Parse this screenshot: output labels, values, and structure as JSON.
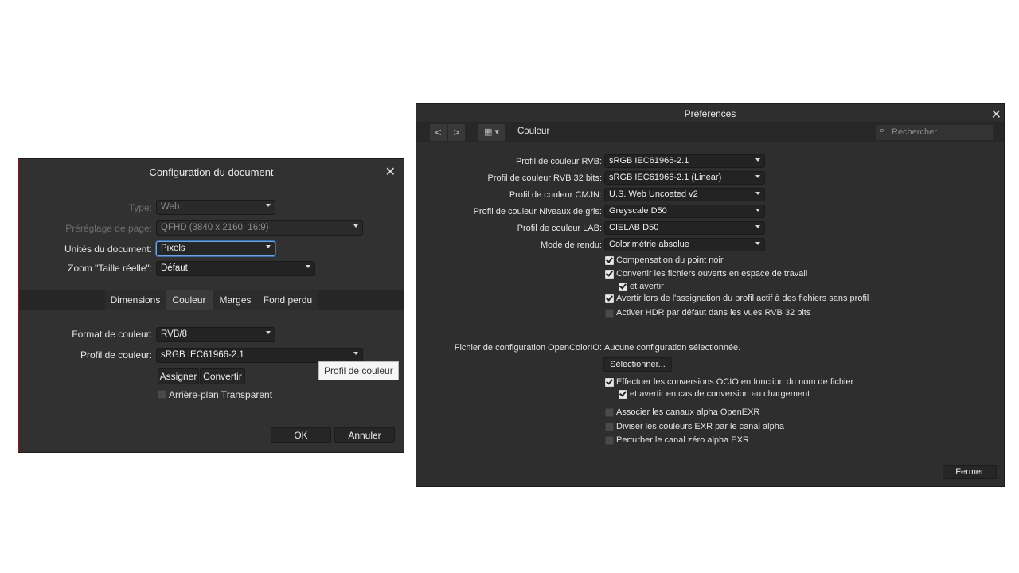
{
  "doc_dialog": {
    "title": "Configuration du document",
    "type_label": "Type:",
    "type_value": "Web",
    "preset_label": "Préréglage de page:",
    "preset_value": "QFHD  (3840 x 2160, 16:9)",
    "units_label": "Unités du document:",
    "units_value": "Pixels",
    "zoom_label": "Zoom \"Taille réelle\":",
    "zoom_value": "Défaut",
    "tabs": [
      "Dimensions",
      "Couleur",
      "Marges",
      "Fond perdu"
    ],
    "active_tab": "Couleur",
    "format_label": "Format de couleur:",
    "format_value": "RVB/8",
    "profile_label": "Profil de couleur:",
    "profile_value": "sRGB IEC61966-2.1",
    "assign_label": "Assigner",
    "convert_label": "Convertir",
    "transparent_label": "Arrière-plan Transparent",
    "tooltip": "Profil de couleur",
    "ok_label": "OK",
    "cancel_label": "Annuler"
  },
  "prefs_dialog": {
    "title": "Préférences",
    "section": "Couleur",
    "search_placeholder": "Rechercher",
    "rows": [
      {
        "label": "Profil de couleur RVB:",
        "value": "sRGB IEC61966-2.1"
      },
      {
        "label": "Profil de couleur RVB 32 bits:",
        "value": "sRGB IEC61966-2.1 (Linear)"
      },
      {
        "label": "Profil de couleur CMJN:",
        "value": "U.S. Web Uncoated v2"
      },
      {
        "label": "Profil de couleur Niveaux de gris:",
        "value": "Greyscale D50"
      },
      {
        "label": "Profil de couleur LAB:",
        "value": "CIELAB D50"
      },
      {
        "label": "Mode de rendu:",
        "value": "Colorimétrie absolue"
      }
    ],
    "checks": [
      {
        "label": "Compensation du point noir",
        "checked": true
      },
      {
        "label": "Convertir les fichiers ouverts en espace de travail",
        "checked": true
      },
      {
        "label": "et avertir",
        "checked": true
      },
      {
        "label": "Avertir lors de l'assignation du profil actif à des fichiers sans profil",
        "checked": true
      },
      {
        "label": "Activer HDR par défaut dans les vues RVB 32 bits",
        "checked": false
      }
    ],
    "ocio_label": "Fichier de configuration OpenColorIO:",
    "ocio_value": "Aucune configuration sélectionnée.",
    "select_label": "Sélectionner...",
    "checks2": [
      {
        "label": "Effectuer les conversions OCIO en fonction du nom de fichier",
        "checked": true
      },
      {
        "label": "et avertir en cas de conversion au chargement",
        "checked": true
      },
      {
        "label": "Associer les canaux alpha OpenEXR",
        "checked": false
      },
      {
        "label": "Diviser les couleurs EXR par le canal alpha",
        "checked": false
      },
      {
        "label": "Perturber le canal zéro alpha EXR",
        "checked": false
      }
    ],
    "close_label": "Fermer"
  }
}
